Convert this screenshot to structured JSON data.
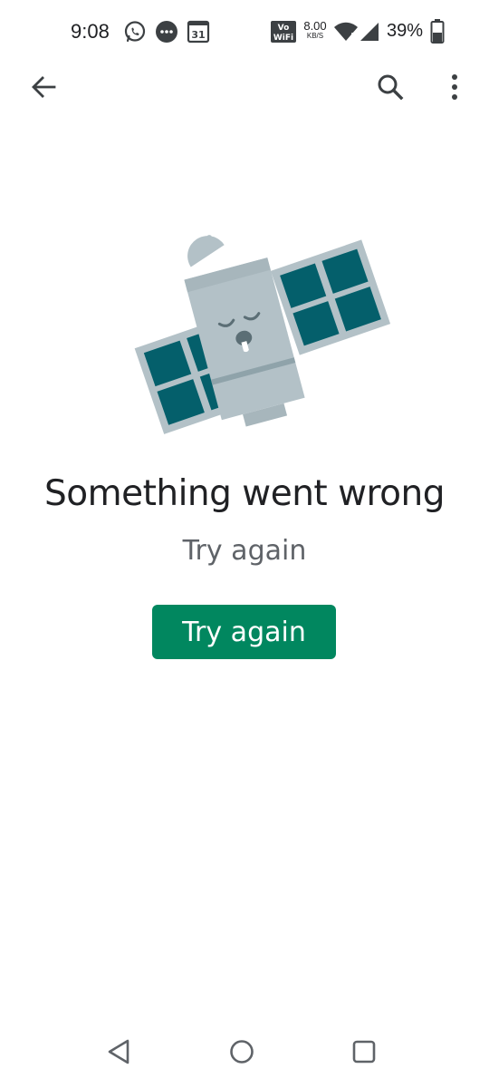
{
  "status_bar": {
    "time": "9:08",
    "net_speed_value": "8.00",
    "net_speed_unit": "KB/S",
    "vowifi_label_top": "Vo",
    "vowifi_label_bottom": "WiFi",
    "calendar_day": "31",
    "battery_percent": "39%",
    "notification_icons": [
      "whatsapp-icon",
      "messages-icon",
      "calendar-icon"
    ],
    "system_icons": [
      "vowifi-icon",
      "wifi-icon",
      "signal-icon",
      "battery-icon"
    ]
  },
  "app_bar": {
    "icons": [
      "back-arrow-icon",
      "search-icon",
      "more-vert-icon"
    ]
  },
  "error": {
    "title": "Something went wrong",
    "subtitle": "Try again",
    "retry_label": "Try again",
    "illustration": "sad-satellite"
  },
  "nav_bar": {
    "icons": [
      "nav-back-icon",
      "nav-home-icon",
      "nav-recents-icon"
    ]
  },
  "colors": {
    "accent": "#01875f",
    "panel": "#045f6b",
    "satellite_body": "#b3c1c7",
    "text_primary": "#202124",
    "text_secondary": "#5f6368"
  }
}
